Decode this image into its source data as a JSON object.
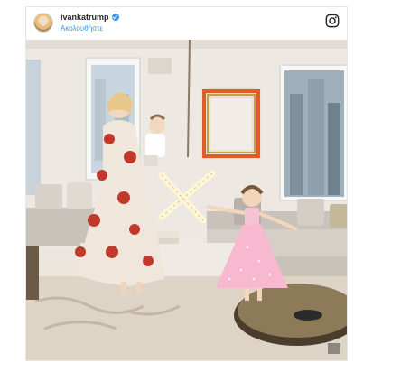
{
  "post": {
    "username": "ivankatrump",
    "follow_label": "Ακολουθήστε",
    "verified_icon": "verified-badge-icon",
    "platform_icon": "instagram-icon",
    "accent_color": "#3897f0",
    "photo_alt": "Photo of a woman holding a toddler beside a girl in a pink dress in an apartment living room"
  }
}
